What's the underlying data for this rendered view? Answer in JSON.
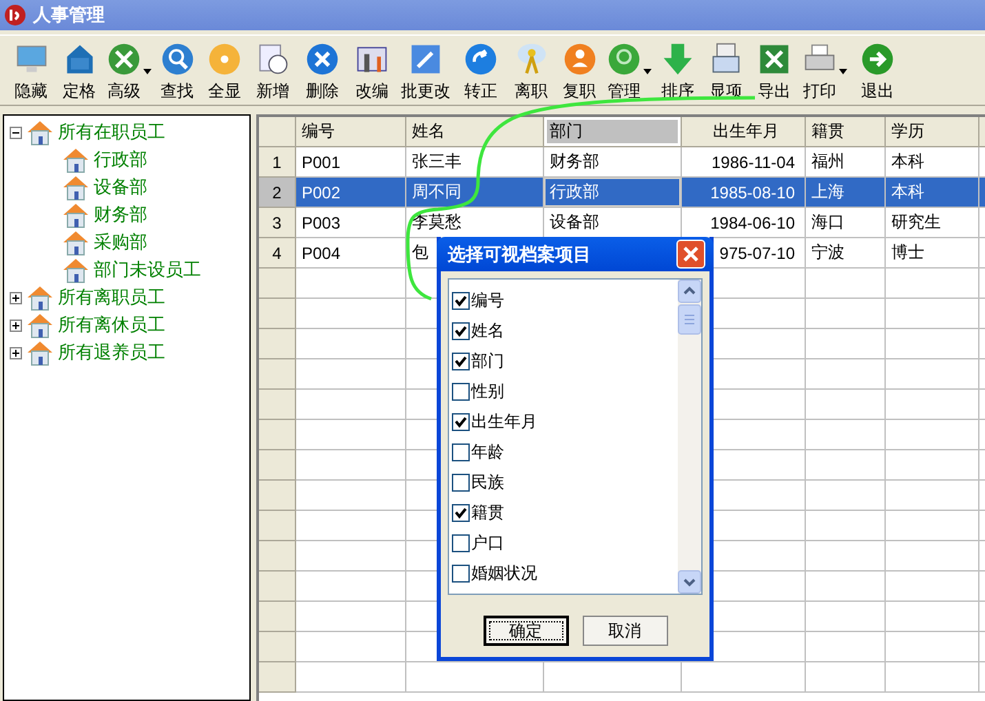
{
  "window": {
    "title": "人事管理"
  },
  "toolbar": [
    {
      "label": "隐藏",
      "has_dropdown": false
    },
    {
      "label": "定格",
      "has_dropdown": false
    },
    {
      "label": "高级",
      "has_dropdown": true
    },
    {
      "label": "查找",
      "has_dropdown": false
    },
    {
      "label": "全显",
      "has_dropdown": false
    },
    {
      "label": "新增",
      "has_dropdown": false
    },
    {
      "label": "删除",
      "has_dropdown": false
    },
    {
      "label": "改编",
      "has_dropdown": false
    },
    {
      "label": "批更改",
      "has_dropdown": false
    },
    {
      "label": "转正",
      "has_dropdown": false
    },
    {
      "label": "离职",
      "has_dropdown": false
    },
    {
      "label": "复职",
      "has_dropdown": false
    },
    {
      "label": "管理",
      "has_dropdown": true
    },
    {
      "label": "排序",
      "has_dropdown": false
    },
    {
      "label": "显项",
      "has_dropdown": false
    },
    {
      "label": "导出",
      "has_dropdown": false
    },
    {
      "label": "打印",
      "has_dropdown": true
    },
    {
      "label": "退出",
      "has_dropdown": false
    }
  ],
  "tree": [
    {
      "label": "所有在职员工",
      "expanded": true,
      "children": [
        {
          "label": "行政部"
        },
        {
          "label": "设备部"
        },
        {
          "label": "财务部"
        },
        {
          "label": "采购部"
        },
        {
          "label": "部门未设员工"
        }
      ]
    },
    {
      "label": "所有离职员工",
      "expanded": false
    },
    {
      "label": "所有离休员工",
      "expanded": false
    },
    {
      "label": "所有退养员工",
      "expanded": false
    }
  ],
  "table": {
    "columns": [
      {
        "label": "编号",
        "selected": false
      },
      {
        "label": "姓名",
        "selected": false
      },
      {
        "label": "部门",
        "selected": true
      },
      {
        "label": "出生年月",
        "selected": false
      },
      {
        "label": "籍贯",
        "selected": false
      },
      {
        "label": "学历",
        "selected": false
      }
    ],
    "rows": [
      {
        "number": "1",
        "selected": false,
        "cells": [
          "P001",
          "张三丰",
          "财务部",
          "1986-11-04",
          "福州",
          "本科"
        ]
      },
      {
        "number": "2",
        "selected": true,
        "cells": [
          "P002",
          "周不同",
          "行政部",
          "1985-08-10",
          "上海",
          "本科"
        ]
      },
      {
        "number": "3",
        "selected": false,
        "cells": [
          "P003",
          "李莫愁",
          "设备部",
          "1984-06-10",
          "海口",
          "研究生"
        ]
      },
      {
        "number": "4",
        "selected": false,
        "cells": [
          "P004",
          "包",
          null,
          "975-07-10",
          "宁波",
          "博士"
        ]
      }
    ]
  },
  "dialog": {
    "title": "选择可视档案项目",
    "items": [
      {
        "label": "编号",
        "checked": true
      },
      {
        "label": "姓名",
        "checked": true
      },
      {
        "label": "部门",
        "checked": true
      },
      {
        "label": "性别",
        "checked": false
      },
      {
        "label": "出生年月",
        "checked": true
      },
      {
        "label": "年龄",
        "checked": false
      },
      {
        "label": "民族",
        "checked": false
      },
      {
        "label": "籍贯",
        "checked": true
      },
      {
        "label": "户口",
        "checked": false
      },
      {
        "label": "婚姻状况",
        "checked": false
      }
    ],
    "buttons": [
      {
        "label": "确定",
        "focused": true
      },
      {
        "label": "取消",
        "focused": false
      }
    ]
  }
}
